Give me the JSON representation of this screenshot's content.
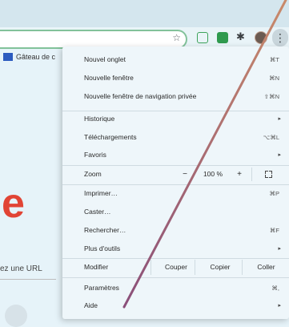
{
  "browser": {
    "bookmark": {
      "label": "Gâteau de c"
    },
    "kebab_icon": "⋮",
    "star_icon": "☆",
    "puzzle_icon": "✱"
  },
  "page": {
    "logo_fragment": "e",
    "url_hint": "ez une URL"
  },
  "menu": {
    "group1": [
      {
        "label": "Nouvel onglet",
        "shortcut": "⌘T"
      },
      {
        "label": "Nouvelle fenêtre",
        "shortcut": "⌘N"
      },
      {
        "label": "Nouvelle fenêtre de navigation privée",
        "shortcut": "⇧⌘N"
      }
    ],
    "group2": [
      {
        "label": "Historique",
        "arrow": "▸"
      },
      {
        "label": "Téléchargements",
        "shortcut": "⌥⌘L"
      },
      {
        "label": "Favoris",
        "arrow": "▸"
      }
    ],
    "zoom": {
      "label": "Zoom",
      "minus": "−",
      "value": "100 %",
      "plus": "+"
    },
    "group3": [
      {
        "label": "Imprimer…",
        "shortcut": "⌘P"
      },
      {
        "label": "Caster…"
      },
      {
        "label": "Rechercher…",
        "shortcut": "⌘F"
      },
      {
        "label": "Plus d'outils",
        "arrow": "▸"
      }
    ],
    "edit": {
      "label": "Modifier",
      "cut": "Couper",
      "copy": "Copier",
      "paste": "Coller"
    },
    "group4": [
      {
        "label": "Paramètres",
        "shortcut": "⌘,"
      },
      {
        "label": "Aide",
        "arrow": "▸"
      }
    ]
  },
  "colors": {
    "accent_green": "#3ca35a",
    "logo_red": "#e14435",
    "stroke_start": "#c98a6a",
    "stroke_end": "#8a4f7a"
  }
}
